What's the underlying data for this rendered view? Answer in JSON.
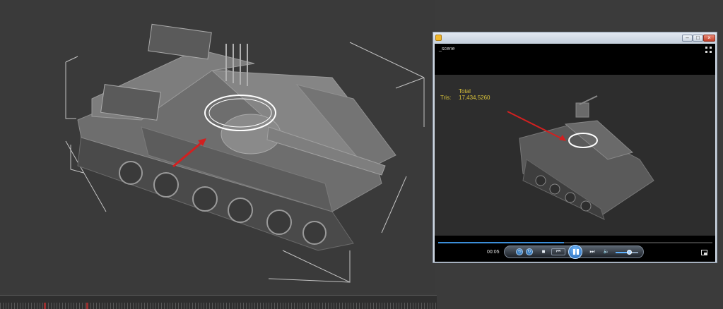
{
  "player": {
    "scene_label": "_scene",
    "stats": {
      "total_label": "Total",
      "tris_label": "Tris:",
      "tris_value": "17,434,5260"
    },
    "time": "00:05",
    "progress_fraction": 0.46,
    "volume_fraction": 0.55,
    "window_buttons": {
      "minimize": "–",
      "maximize": "□",
      "close": "×"
    },
    "controls": {
      "shuffle_icon": "shuffle-icon",
      "repeat_icon": "repeat-icon",
      "stop_glyph": "■",
      "prev_glyph": "⏮",
      "next_glyph": "⏭",
      "volume_glyph": "🔈"
    }
  },
  "colors": {
    "stats_text": "#d8c23a",
    "arrow": "#d22020",
    "accent": "#3c8ed8"
  }
}
